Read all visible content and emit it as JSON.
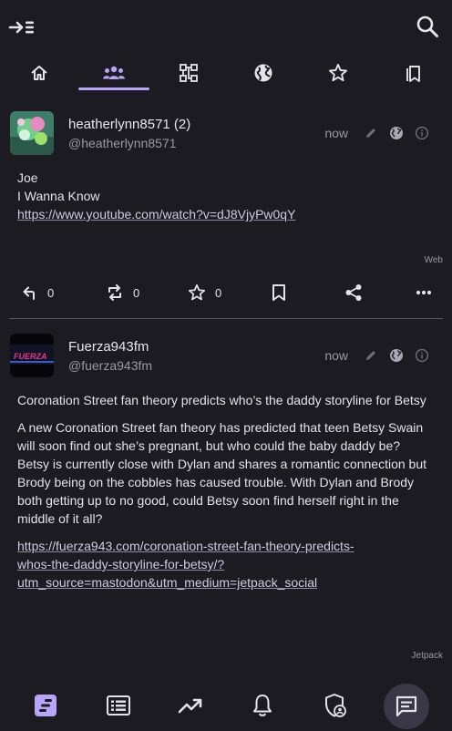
{
  "colors": {
    "background": "#1c1b22",
    "accent": "#b9a5f5",
    "text": "#e4e3ea",
    "muted": "#9a98a3",
    "divider": "#55535e"
  },
  "header": {
    "compose_icon": "compose-icon",
    "search_icon": "search-icon"
  },
  "tabs": [
    {
      "icon": "home-icon",
      "active": false
    },
    {
      "icon": "people-icon",
      "active": true
    },
    {
      "icon": "hierarchy-icon",
      "active": false
    },
    {
      "icon": "globe-icon",
      "active": false
    },
    {
      "icon": "star-icon",
      "active": false
    },
    {
      "icon": "bookmarks-icon",
      "active": false
    }
  ],
  "posts": [
    {
      "display_name": "heatherlynn8571 (2)",
      "handle": "@heatherlynn8571",
      "time": "now",
      "content": [
        "Joe",
        "I Wanna Know"
      ],
      "link": "https://www.youtube.com/watch?v=dJ8VjyPw0qY",
      "source": "Web",
      "replies": "0",
      "boosts": "0",
      "favourites": "0"
    },
    {
      "display_name": "Fuerza943fm",
      "handle": "@fuerza943fm",
      "time": "now",
      "avatar_text": "FUERZA",
      "title": "Coronation Street fan theory predicts who’s the daddy storyline for Betsy",
      "content": "A new Coronation Street fan theory has predicted that teen Betsy Swain will soon find out she’s pregnant, but who could the baby daddy be? Betsy is currently close with Dylan and shares a romantic connection but Brody being on the cobbles has caused trouble. With Dylan and Brody both getting up to no good, could Betsy soon find herself right in the middle of it all?",
      "link_lines": [
        "https://fuerza943.com/coronation-street-fan-theory-predicts-",
        "whos-the-daddy-storyline-for-betsy/?",
        "utm_source=mastodon&utm_medium=jetpack_social"
      ],
      "source": "Jetpack"
    }
  ],
  "bottom_nav": [
    {
      "icon": "timeline-icon",
      "active": true
    },
    {
      "icon": "list-icon",
      "active": false
    },
    {
      "icon": "trending-icon",
      "active": false
    },
    {
      "icon": "bell-icon",
      "active": false
    },
    {
      "icon": "shield-user-icon",
      "active": false
    }
  ],
  "fab": {
    "icon": "message-icon"
  }
}
